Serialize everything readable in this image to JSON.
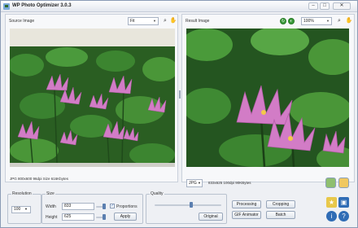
{
  "window": {
    "title": "WP Photo Optimizer 3.0.3"
  },
  "source": {
    "label": "Source Image",
    "zoom": "Fit",
    "info": "JPG 800x600 96dpi  Size 616Kbytes"
  },
  "result": {
    "label": "Result Image",
    "zoom": "100%",
    "format": "JPG",
    "info": "833x625 100dpi 90KBytes"
  },
  "resolution": {
    "title": "Resolution",
    "value": "100"
  },
  "size": {
    "title": "Size",
    "width_label": "Width",
    "width_value": "833",
    "height_label": "Height",
    "height_value": "625",
    "proportions_label": "Proportions",
    "proportions_checked": true,
    "apply_label": "Apply"
  },
  "quality": {
    "title": "Quality",
    "original_label": "Original",
    "level": 0.55
  },
  "actions": {
    "processing": "Processing",
    "cropping": "Cropping",
    "gif_animator": "GIF Animator",
    "batch": "Batch"
  },
  "colors": {
    "titlebar": "#e3e7ef",
    "accent": "#3c9b3c",
    "leaf": "#2f7a2a",
    "flower": "#d27cc6"
  }
}
